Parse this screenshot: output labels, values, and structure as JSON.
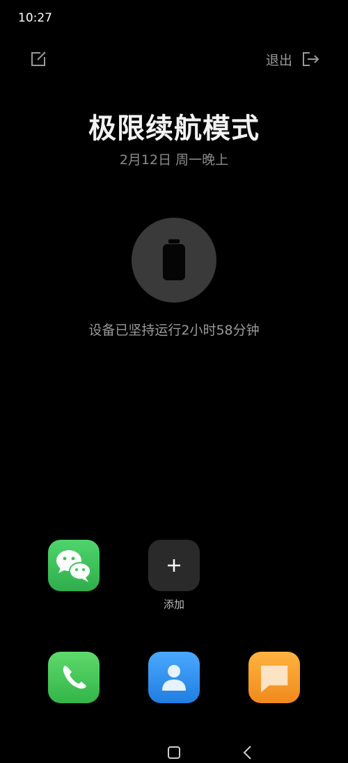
{
  "status_bar": {
    "time": "10:27"
  },
  "header": {
    "exit_label": "退出"
  },
  "main": {
    "title": "极限续航模式",
    "date": "2月12日 周一晚上",
    "uptime": "设备已坚持运行2小时58分钟"
  },
  "apps": [
    {
      "icon": "wechat-icon",
      "label": ""
    },
    {
      "icon": "plus-icon",
      "label": "添加"
    }
  ],
  "dock": [
    {
      "icon": "phone-icon"
    },
    {
      "icon": "contacts-icon"
    },
    {
      "icon": "message-icon"
    }
  ],
  "colors": {
    "background": "#000000",
    "circle": "#3a3a3a",
    "wechat_green": "#3cc25a",
    "contacts_blue": "#2f8ff0",
    "message_orange": "#f59a2a"
  }
}
